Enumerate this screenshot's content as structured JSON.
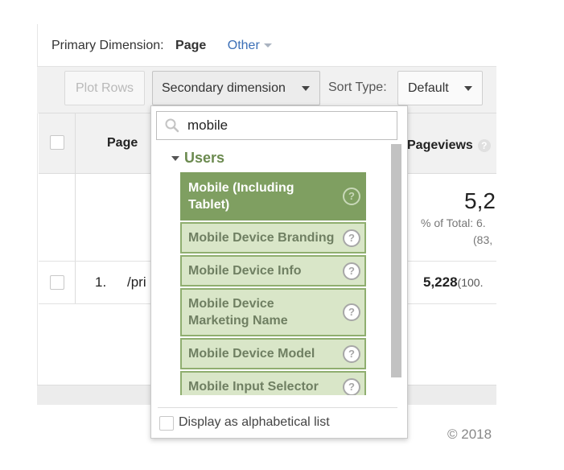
{
  "primary_dimension": {
    "label": "Primary Dimension:",
    "selected": "Page",
    "other": "Other"
  },
  "toolbar": {
    "plot_rows": "Plot Rows",
    "secondary_dimension": "Secondary dimension",
    "sort_type_label": "Sort Type:",
    "sort_type_value": "Default"
  },
  "table": {
    "headers": {
      "page": "Page",
      "pageviews": "Pageviews"
    },
    "totals": {
      "pageviews": "5,2",
      "percent_line": "% of Total: 6.",
      "percent_paren": "(83,"
    },
    "rows": [
      {
        "index": "1.",
        "page": "/pri",
        "pageviews": "5,228",
        "percent": "(100."
      }
    ]
  },
  "dropdown": {
    "search_value": "mobile",
    "group": "Users",
    "items": [
      {
        "label": "Mobile (Including Tablet)"
      },
      {
        "label": "Mobile Device Branding"
      },
      {
        "label": "Mobile Device Info"
      },
      {
        "label": "Mobile Device Marketing Name"
      },
      {
        "label": "Mobile Device Model"
      },
      {
        "label": "Mobile Input Selector"
      }
    ],
    "alphabetical_label": "Display as alphabetical list"
  },
  "footer": {
    "copyright": "© 2018"
  },
  "colors": {
    "accent_link": "#3b6fb6",
    "item_bg": "#d9e6c8",
    "item_active_bg": "#7f9f61",
    "group_text": "#6b8a4f"
  },
  "icons": [
    "search-icon",
    "help-icon",
    "chevron-down-icon",
    "caret-down-icon"
  ]
}
